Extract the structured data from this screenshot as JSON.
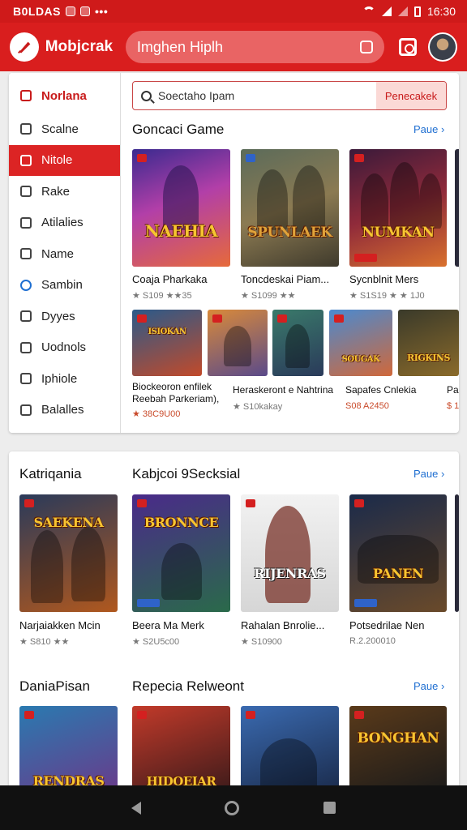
{
  "status": {
    "left_text": "B0LDAS",
    "time": "16:30",
    "icons": [
      "app-icon-a",
      "app-icon-b",
      "more-dots"
    ]
  },
  "appbar": {
    "brand": "Mobjcrak",
    "search_text": "Imghen Hiplh"
  },
  "sidebar": {
    "items": [
      {
        "label": "Norlana",
        "icon": "bookmark-icon"
      },
      {
        "label": "Scalne",
        "icon": "lock-icon"
      },
      {
        "label": "Nitole",
        "icon": "doc-icon"
      },
      {
        "label": "Rake",
        "icon": "pen-icon"
      },
      {
        "label": "Atilalies",
        "icon": "list-icon"
      },
      {
        "label": "Name",
        "icon": "user-icon"
      },
      {
        "label": "Sambin",
        "icon": "circle-icon"
      },
      {
        "label": "Dyyes",
        "icon": "tag-icon"
      },
      {
        "label": "Uodnols",
        "icon": "search-icon"
      },
      {
        "label": "Iphiole",
        "icon": "chat-icon"
      },
      {
        "label": "Balalles",
        "icon": "tools-icon"
      }
    ]
  },
  "search": {
    "placeholder": "Soectaho Ipam",
    "button": "Penecakek"
  },
  "section1": {
    "title": "Goncaci Game",
    "more": "Paue ›",
    "row1": [
      {
        "art": "NAEHIA",
        "name": "Coaja Pharkaka",
        "rating": "★ S109 ★★35"
      },
      {
        "art": "SPUNLAEK",
        "name": "Toncdeskai Piam...",
        "rating": "★ S1099 ★★"
      },
      {
        "art": "NUMKAN",
        "name": "Sycnblnit Mers",
        "rating": "★ S1S19 ★ ★ 1J0"
      }
    ],
    "row2": [
      {
        "art": "ISIOKAN"
      },
      {
        "art": ""
      },
      {
        "art": ""
      },
      {
        "art": "SOUGAK"
      },
      {
        "art": "RIGKINS"
      }
    ],
    "row2_names": [
      {
        "name": "Biockeoron enfilek",
        "name2": "Reebah Parkeriam),",
        "rating": "★ 38C9U00"
      },
      {
        "name": "Heraskeront e Nahtrina",
        "rating": "★ S10kakay"
      },
      {
        "name": "Sapafes Cnlekia",
        "rating": "S08 A2450"
      },
      {
        "name": "Pa",
        "rating": "$ 1"
      }
    ]
  },
  "section2": {
    "left_title": "Katriqania",
    "title": "Kabjcoi 9Secksial",
    "more": "Paue ›",
    "items": [
      {
        "art": "SAEKENA",
        "name": "Narjaiakken Mcin",
        "rating": "★ S810 ★★"
      },
      {
        "art": "BRONNCE",
        "name": "Beera Ma Merk",
        "rating": "★ S2U5c00"
      },
      {
        "art": "RIJENRAS",
        "name": "Rahalan Bnrolie...",
        "rating": "★ S10900"
      },
      {
        "art": "PANEN",
        "name": "Potsedrilae Nen",
        "rating": "R.2.200010"
      }
    ]
  },
  "section3": {
    "left_title": "DaniaPisan",
    "title": "Repecia Relweont",
    "more": "Paue ›",
    "items": [
      {
        "art": "RENDRAS"
      },
      {
        "art": "HIDOEIAR"
      },
      {
        "art": ""
      },
      {
        "art": "BONGHAN"
      }
    ]
  },
  "colors": {
    "brand_red": "#d91e1e",
    "link_blue": "#1f6fd1",
    "active_red": "#dc2424"
  }
}
